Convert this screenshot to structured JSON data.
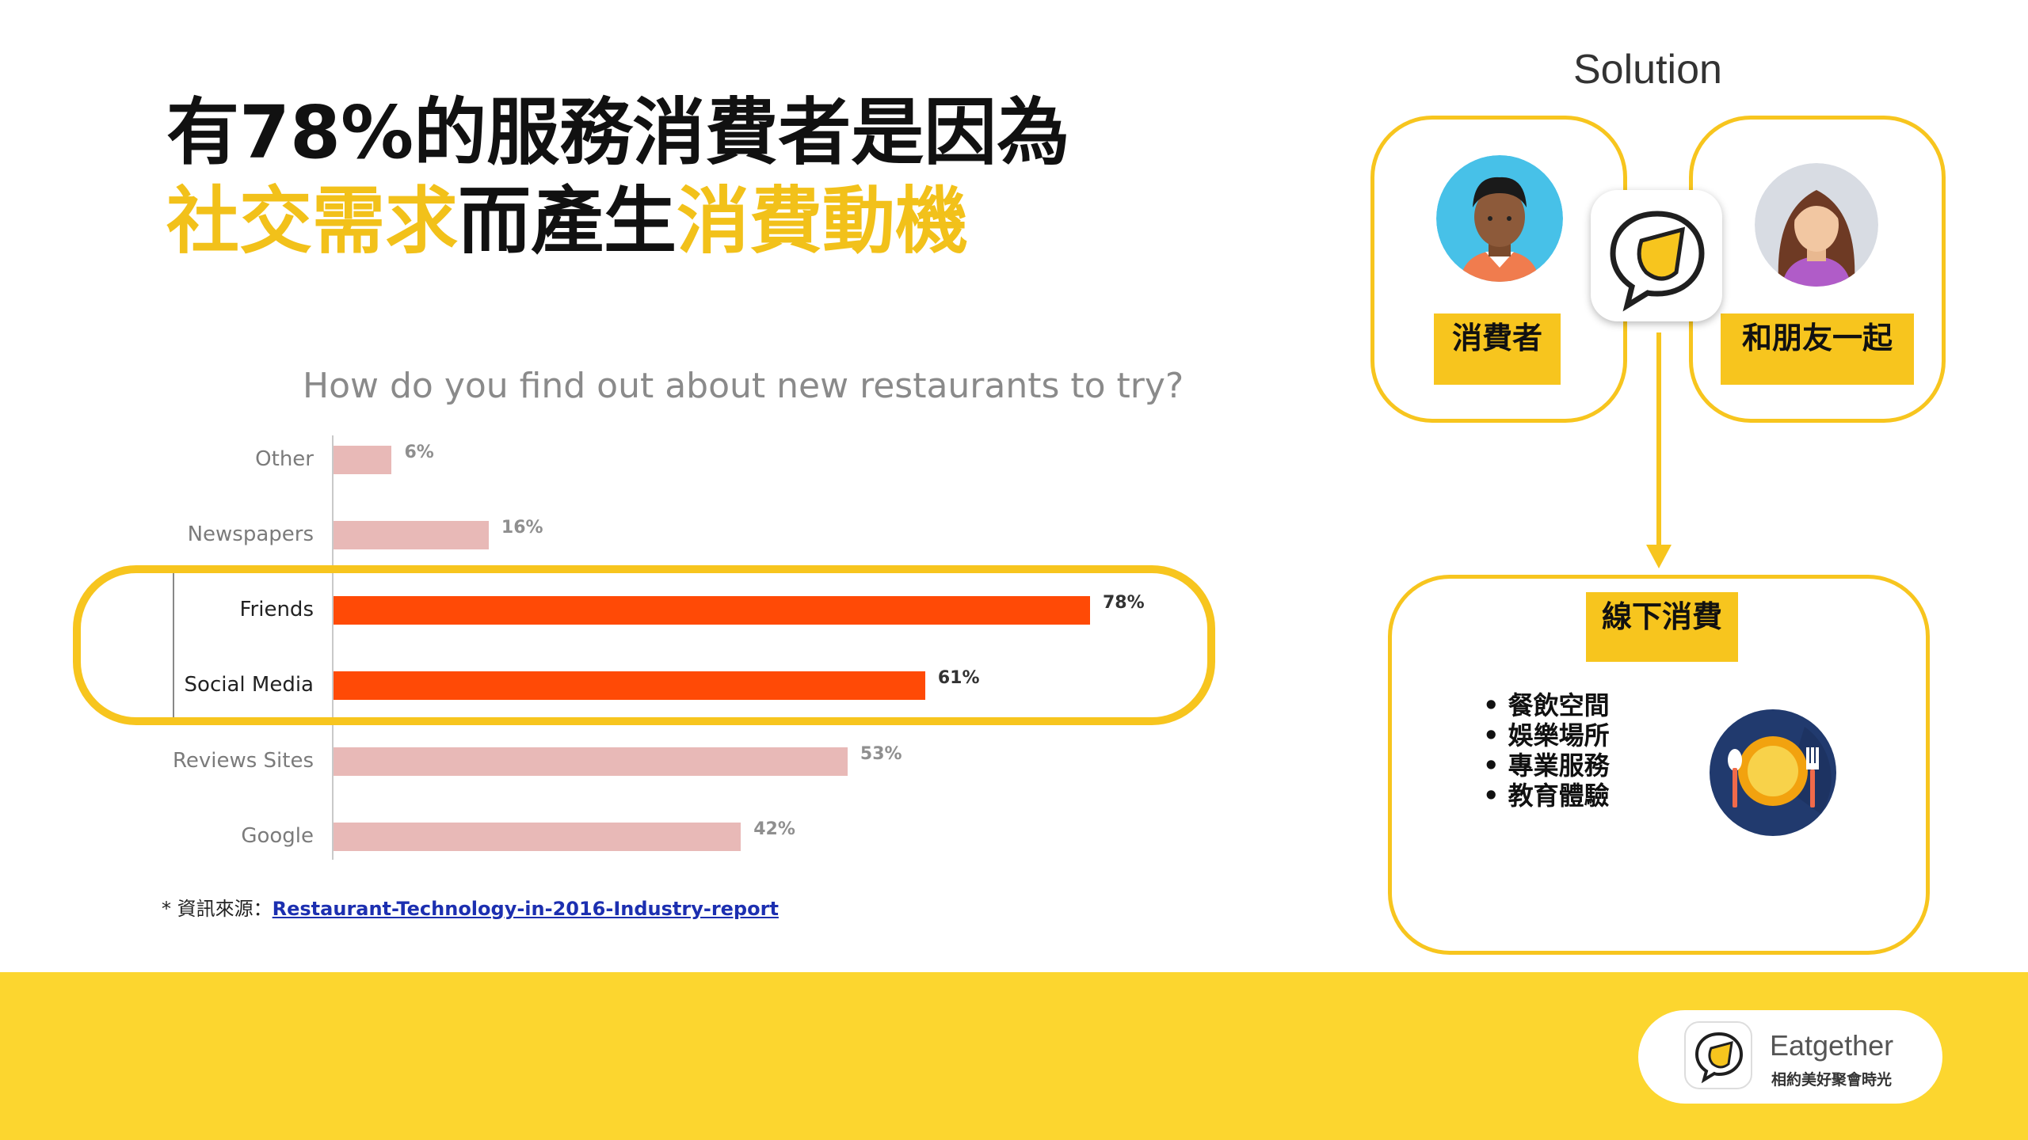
{
  "headline": {
    "line1": "有78%的服務消費者是因為",
    "line2_part1": "社交需求",
    "line2_part2": "而產生",
    "line2_part3": "消費動機"
  },
  "colors": {
    "accent_yellow": "#f7c51e",
    "footer_yellow": "#fcd62f",
    "bar_highlight": "#ff4a06",
    "bar_normal": "#e8b9b7"
  },
  "chart_data": {
    "type": "bar",
    "orientation": "horizontal",
    "title": "How do you find out about new restaurants to try?",
    "categories": [
      "Other",
      "Newspapers",
      "Friends",
      "Social Media",
      "Reviews Sites",
      "Google"
    ],
    "values": [
      6,
      16,
      78,
      61,
      53,
      42
    ],
    "value_labels": [
      "6%",
      "16%",
      "78%",
      "61%",
      "53%",
      "42%"
    ],
    "highlighted": [
      "Friends",
      "Social Media"
    ],
    "xlim": [
      0,
      100
    ],
    "grid": false
  },
  "source": {
    "prefix": "* 資訊來源：",
    "link_text": "Restaurant-Technology-in-2016-Industry-report"
  },
  "solution": {
    "title": "Solution",
    "consumer_label": "消費者",
    "friends_label": "和朋友一起",
    "offline_label": "線下消費",
    "items": [
      "餐飲空間",
      "娛樂場所",
      "專業服務",
      "教育體驗"
    ],
    "bullet": "•"
  },
  "brand": {
    "name": "Eatgether",
    "tagline": "相約美好聚會時光"
  }
}
